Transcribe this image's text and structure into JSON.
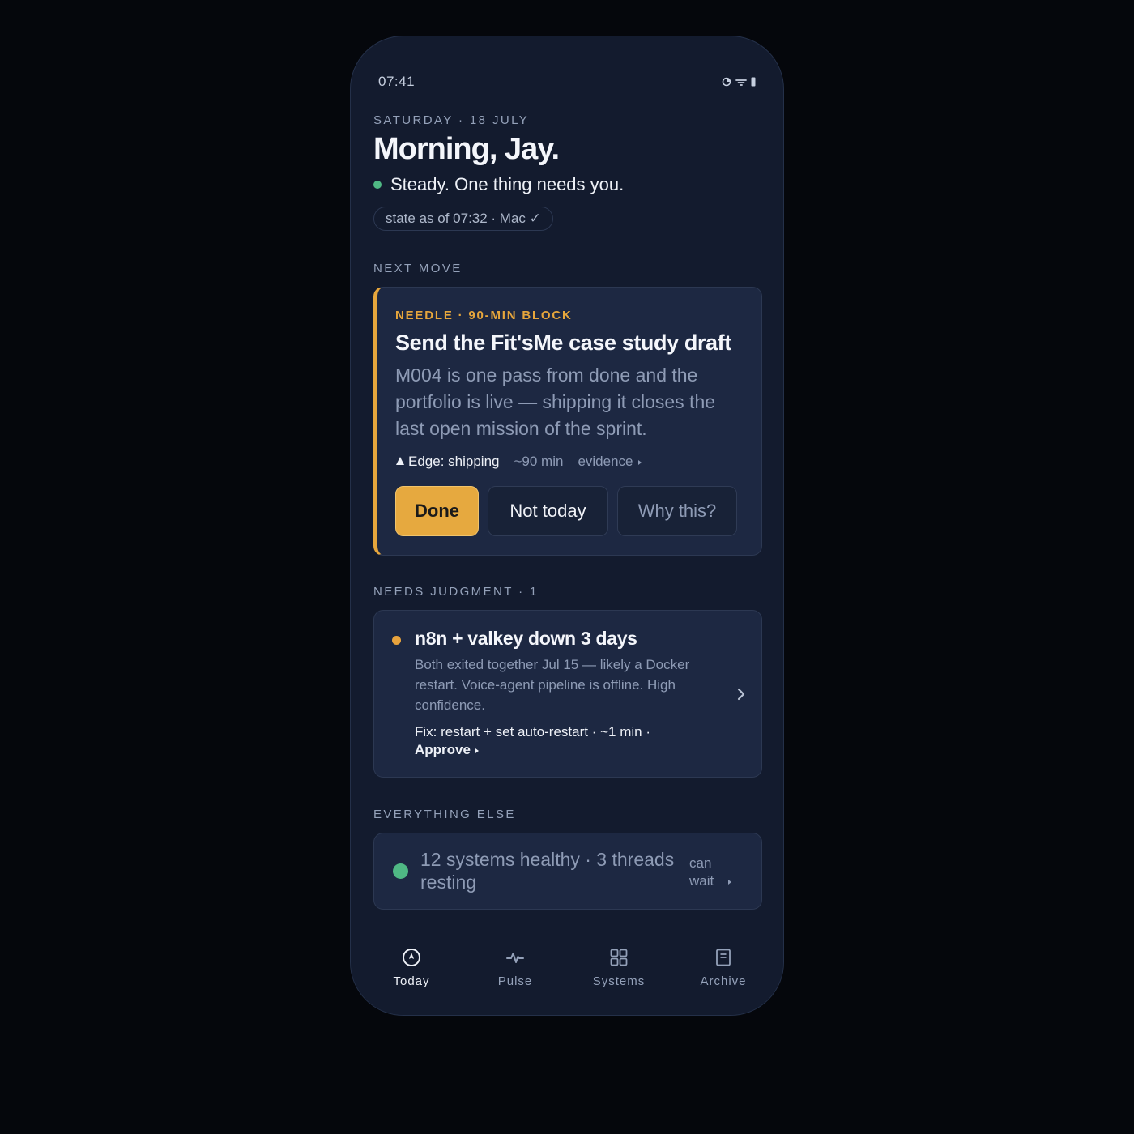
{
  "status_bar": {
    "time": "07:41"
  },
  "header": {
    "date": "SATURDAY · 18 JULY",
    "greeting": "Morning, Jay.",
    "mood": "Steady. One thing needs you.",
    "sync": "state as of 07:32 · Mac ✓"
  },
  "next_move": {
    "section_label": "NEXT MOVE",
    "tag": "NEEDLE · 90-MIN BLOCK",
    "title": "Send the Fit'sMe case study draft",
    "description": "M004 is one pass from done and the portfolio is live — shipping it closes the last open mission of the sprint.",
    "edge": "Edge: shipping",
    "duration": "~90 min",
    "evidence": "evidence",
    "actions": {
      "done": "Done",
      "not_today": "Not today",
      "why": "Why this?"
    }
  },
  "needs_judgment": {
    "section_label": "NEEDS JUDGMENT · 1",
    "item": {
      "title": "n8n + valkey down 3 days",
      "description": "Both exited together Jul 15 — likely a Docker restart. Voice-agent pipeline is offline. High confidence.",
      "fix": "Fix: restart + set auto-restart · ~1 min ·",
      "approve": "Approve"
    }
  },
  "everything_else": {
    "section_label": "EVERYTHING ELSE",
    "summary": "12 systems healthy · 3 threads resting",
    "link": "can wait"
  },
  "tabs": [
    {
      "label": "Today",
      "icon": "compass-icon",
      "active": true
    },
    {
      "label": "Pulse",
      "icon": "pulse-icon",
      "active": false
    },
    {
      "label": "Systems",
      "icon": "grid-icon",
      "active": false
    },
    {
      "label": "Archive",
      "icon": "archive-icon",
      "active": false
    }
  ],
  "colors": {
    "background": "#05070c",
    "phone": "#131b2e",
    "card": "#1d2842",
    "accent": "#e6a63c",
    "healthy": "#4fb884",
    "alert": "#e8a33d"
  }
}
